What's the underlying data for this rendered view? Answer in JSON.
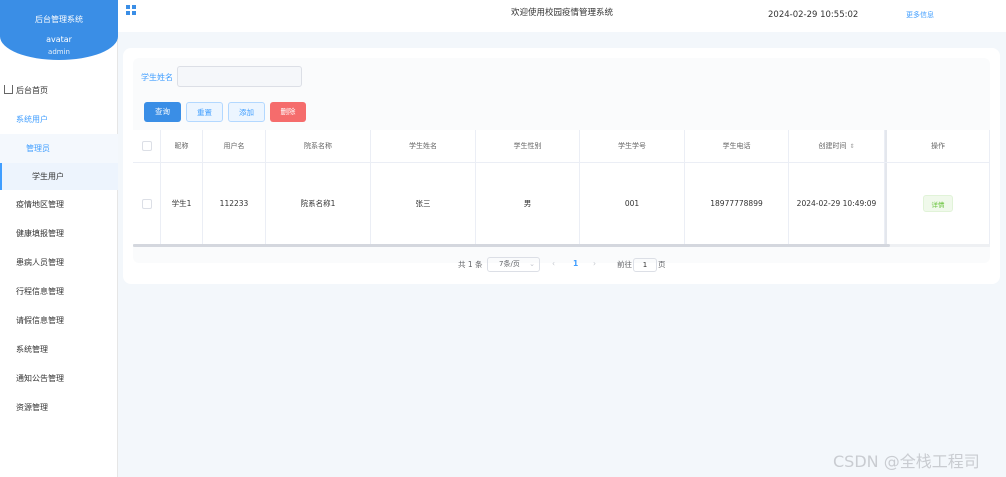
{
  "sidebar": {
    "brand": "后台管理系统",
    "avatar_alt": "avatar",
    "username": "admin",
    "items": [
      {
        "label": "后台首页"
      },
      {
        "label": "系统用户"
      },
      {
        "label": "管理员"
      },
      {
        "label": "学生用户"
      },
      {
        "label": "疫情地区管理"
      },
      {
        "label": "健康填报管理"
      },
      {
        "label": "患病人员管理"
      },
      {
        "label": "行程信息管理"
      },
      {
        "label": "请假信息管理"
      },
      {
        "label": "系统管理"
      },
      {
        "label": "通知公告管理"
      },
      {
        "label": "资源管理"
      }
    ]
  },
  "header": {
    "title": "欢迎使用校园疫情管理系统",
    "datetime": "2024-02-29 10:55:02",
    "more": "更多信息"
  },
  "search": {
    "label": "学生姓名",
    "value": ""
  },
  "buttons": {
    "query": "查询",
    "reset": "重置",
    "add": "添加",
    "delete": "删除"
  },
  "table": {
    "headers": [
      "昵称",
      "用户名",
      "院系名称",
      "学生姓名",
      "学生性别",
      "学生学号",
      "学生电话",
      "创建时间",
      "操作"
    ],
    "rows": [
      [
        "学生1",
        "112233",
        "院系名称1",
        "张三",
        "男",
        "001",
        "18977778899",
        "2024-02-29 10:49:09",
        "详情"
      ]
    ]
  },
  "pagination": {
    "total": "共 1 条",
    "page_size": "7条/页",
    "prev": "‹",
    "page": "1",
    "next": "›",
    "goto": "前往",
    "goto_value": "1",
    "page_unit": "页"
  },
  "watermark": "CSDN @全栈工程司"
}
